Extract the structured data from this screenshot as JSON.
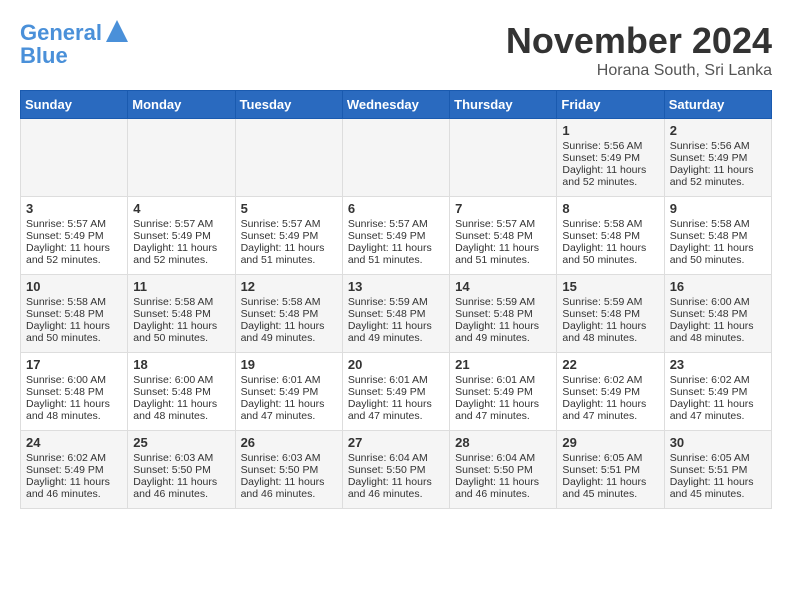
{
  "header": {
    "logo_line1": "General",
    "logo_line2": "Blue",
    "month": "November 2024",
    "location": "Horana South, Sri Lanka"
  },
  "days_of_week": [
    "Sunday",
    "Monday",
    "Tuesday",
    "Wednesday",
    "Thursday",
    "Friday",
    "Saturday"
  ],
  "weeks": [
    [
      {
        "day": "",
        "info": ""
      },
      {
        "day": "",
        "info": ""
      },
      {
        "day": "",
        "info": ""
      },
      {
        "day": "",
        "info": ""
      },
      {
        "day": "",
        "info": ""
      },
      {
        "day": "1",
        "info": "Sunrise: 5:56 AM\nSunset: 5:49 PM\nDaylight: 11 hours and 52 minutes."
      },
      {
        "day": "2",
        "info": "Sunrise: 5:56 AM\nSunset: 5:49 PM\nDaylight: 11 hours and 52 minutes."
      }
    ],
    [
      {
        "day": "3",
        "info": "Sunrise: 5:57 AM\nSunset: 5:49 PM\nDaylight: 11 hours and 52 minutes."
      },
      {
        "day": "4",
        "info": "Sunrise: 5:57 AM\nSunset: 5:49 PM\nDaylight: 11 hours and 52 minutes."
      },
      {
        "day": "5",
        "info": "Sunrise: 5:57 AM\nSunset: 5:49 PM\nDaylight: 11 hours and 51 minutes."
      },
      {
        "day": "6",
        "info": "Sunrise: 5:57 AM\nSunset: 5:49 PM\nDaylight: 11 hours and 51 minutes."
      },
      {
        "day": "7",
        "info": "Sunrise: 5:57 AM\nSunset: 5:48 PM\nDaylight: 11 hours and 51 minutes."
      },
      {
        "day": "8",
        "info": "Sunrise: 5:58 AM\nSunset: 5:48 PM\nDaylight: 11 hours and 50 minutes."
      },
      {
        "day": "9",
        "info": "Sunrise: 5:58 AM\nSunset: 5:48 PM\nDaylight: 11 hours and 50 minutes."
      }
    ],
    [
      {
        "day": "10",
        "info": "Sunrise: 5:58 AM\nSunset: 5:48 PM\nDaylight: 11 hours and 50 minutes."
      },
      {
        "day": "11",
        "info": "Sunrise: 5:58 AM\nSunset: 5:48 PM\nDaylight: 11 hours and 50 minutes."
      },
      {
        "day": "12",
        "info": "Sunrise: 5:58 AM\nSunset: 5:48 PM\nDaylight: 11 hours and 49 minutes."
      },
      {
        "day": "13",
        "info": "Sunrise: 5:59 AM\nSunset: 5:48 PM\nDaylight: 11 hours and 49 minutes."
      },
      {
        "day": "14",
        "info": "Sunrise: 5:59 AM\nSunset: 5:48 PM\nDaylight: 11 hours and 49 minutes."
      },
      {
        "day": "15",
        "info": "Sunrise: 5:59 AM\nSunset: 5:48 PM\nDaylight: 11 hours and 48 minutes."
      },
      {
        "day": "16",
        "info": "Sunrise: 6:00 AM\nSunset: 5:48 PM\nDaylight: 11 hours and 48 minutes."
      }
    ],
    [
      {
        "day": "17",
        "info": "Sunrise: 6:00 AM\nSunset: 5:48 PM\nDaylight: 11 hours and 48 minutes."
      },
      {
        "day": "18",
        "info": "Sunrise: 6:00 AM\nSunset: 5:48 PM\nDaylight: 11 hours and 48 minutes."
      },
      {
        "day": "19",
        "info": "Sunrise: 6:01 AM\nSunset: 5:49 PM\nDaylight: 11 hours and 47 minutes."
      },
      {
        "day": "20",
        "info": "Sunrise: 6:01 AM\nSunset: 5:49 PM\nDaylight: 11 hours and 47 minutes."
      },
      {
        "day": "21",
        "info": "Sunrise: 6:01 AM\nSunset: 5:49 PM\nDaylight: 11 hours and 47 minutes."
      },
      {
        "day": "22",
        "info": "Sunrise: 6:02 AM\nSunset: 5:49 PM\nDaylight: 11 hours and 47 minutes."
      },
      {
        "day": "23",
        "info": "Sunrise: 6:02 AM\nSunset: 5:49 PM\nDaylight: 11 hours and 47 minutes."
      }
    ],
    [
      {
        "day": "24",
        "info": "Sunrise: 6:02 AM\nSunset: 5:49 PM\nDaylight: 11 hours and 46 minutes."
      },
      {
        "day": "25",
        "info": "Sunrise: 6:03 AM\nSunset: 5:50 PM\nDaylight: 11 hours and 46 minutes."
      },
      {
        "day": "26",
        "info": "Sunrise: 6:03 AM\nSunset: 5:50 PM\nDaylight: 11 hours and 46 minutes."
      },
      {
        "day": "27",
        "info": "Sunrise: 6:04 AM\nSunset: 5:50 PM\nDaylight: 11 hours and 46 minutes."
      },
      {
        "day": "28",
        "info": "Sunrise: 6:04 AM\nSunset: 5:50 PM\nDaylight: 11 hours and 46 minutes."
      },
      {
        "day": "29",
        "info": "Sunrise: 6:05 AM\nSunset: 5:51 PM\nDaylight: 11 hours and 45 minutes."
      },
      {
        "day": "30",
        "info": "Sunrise: 6:05 AM\nSunset: 5:51 PM\nDaylight: 11 hours and 45 minutes."
      }
    ]
  ]
}
